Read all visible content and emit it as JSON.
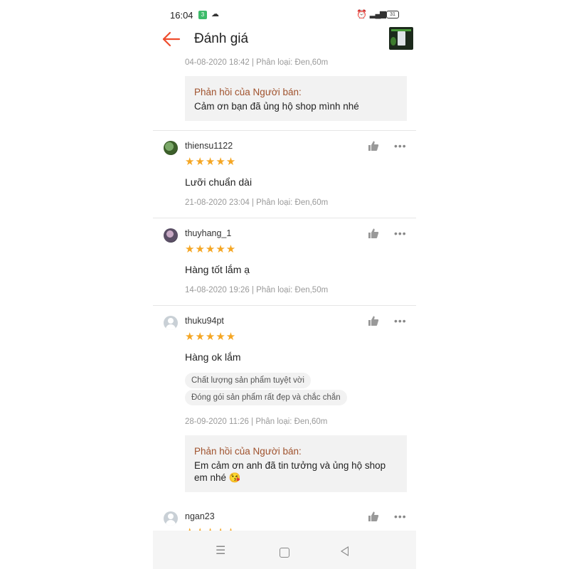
{
  "status_bar": {
    "time": "16:04",
    "notification_badge": "3",
    "battery": "31",
    "icons": [
      "cloud-icon",
      "alarm-icon",
      "signal-icon",
      "battery-icon"
    ]
  },
  "header": {
    "title": "Đánh giá",
    "back_icon": "arrow-left-icon",
    "accent_color": "#ee4d2d"
  },
  "top_review_tail": {
    "meta": "04-08-2020 18:42 | Phân loại: Đen,60m",
    "seller_reply": {
      "label": "Phản hồi của Người bán:",
      "text": "Cảm ơn bạn đã ủng hộ shop mình nhé"
    }
  },
  "reviews": [
    {
      "username": "thiensu1122",
      "stars": "★★★★★",
      "rating": 5,
      "text": "Lưỡi chuẩn dài",
      "meta": "21-08-2020 23:04 | Phân loại: Đen,60m"
    },
    {
      "username": "thuyhang_1",
      "stars": "★★★★★",
      "rating": 5,
      "text": "Hàng tốt lắm ạ",
      "meta": "14-08-2020 19:26 | Phân loại: Đen,50m"
    },
    {
      "username": "thuku94pt",
      "stars": "★★★★★",
      "rating": 5,
      "text": "Hàng ok lắm",
      "tags": [
        "Chất lượng sản phẩm tuyệt vời",
        "Đóng gói sản phẩm rất đẹp và chắc chắn"
      ],
      "meta": "28-09-2020 11:26 | Phân loại: Đen,60m",
      "seller_reply": {
        "label": "Phản hồi của Người bán:",
        "text": "Em cảm ơn anh đã tin tưởng và ủng hộ shop em nhé 😘"
      }
    },
    {
      "username": "ngan23",
      "stars": "★★★★★",
      "rating": 5
    }
  ],
  "colors": {
    "star": "#f5a623",
    "reply_label": "#a0522d",
    "reply_background": "#f2f2f2",
    "meta_text": "#9a9a9a"
  },
  "nav_bar": {
    "icons": [
      "menu-icon",
      "home-square-icon",
      "back-triangle-icon"
    ]
  }
}
